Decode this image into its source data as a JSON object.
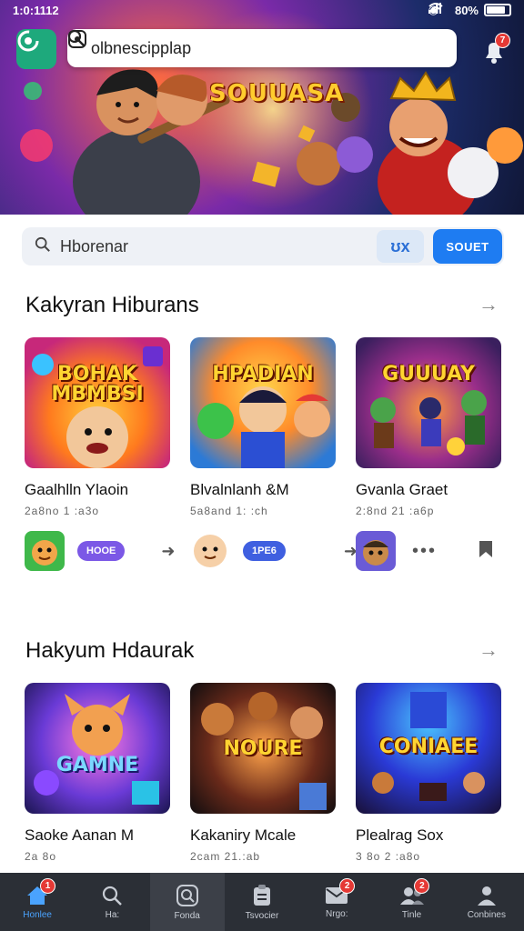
{
  "status_bar": {
    "time": "1:0:1112",
    "battery": "80%"
  },
  "top_search": {
    "value": "olbnescipplap"
  },
  "notifications": {
    "count": "7"
  },
  "hero": {
    "title": "SOUUASA"
  },
  "search2": {
    "value": "Hborenar",
    "clear_label": "ʊx",
    "button": "SOUET"
  },
  "sections": [
    {
      "title": "Kakyran Hiburans",
      "cards": [
        {
          "title": "Gaalhlln Ylaoin",
          "meta": "2a8no 1 :a3o",
          "art": "BOHAK MBMBSI"
        },
        {
          "title": "Blvalnlanh &M",
          "meta": "5a8and 1: :ch",
          "art": "HPADIAN"
        },
        {
          "title": "Gvanla Graet",
          "meta": "2:8nd 21 :a6p",
          "art": "GUUUAY"
        }
      ],
      "actions": [
        {
          "pill": "HOOE",
          "pill_color": "#7b58e6"
        },
        {
          "pill": "1PE6",
          "pill_color": "#3f5fe0"
        }
      ]
    },
    {
      "title": "Hakyum Hdaurak",
      "cards": [
        {
          "title": "Saoke Aanan M",
          "meta": "2a 8o",
          "art": "GAMNE"
        },
        {
          "title": "Kakaniry Mcale",
          "meta": "2cam 21.:ab",
          "art": "NOURE"
        },
        {
          "title": "Plealrag Sox",
          "meta": "3 8o 2 :a8o",
          "art": "CONIAEE"
        }
      ]
    }
  ],
  "bottom_nav": [
    {
      "label": "Honlee",
      "icon": "home-icon",
      "badge": "1"
    },
    {
      "label": "Ha:",
      "icon": "search-icon",
      "badge": ""
    },
    {
      "label": "Fonda",
      "icon": "lens-icon",
      "badge": ""
    },
    {
      "label": "Tsvocier",
      "icon": "clipboard-icon",
      "badge": ""
    },
    {
      "label": "Nrgo:",
      "icon": "mail-icon",
      "badge": "2"
    },
    {
      "label": "Tinle",
      "icon": "people-icon",
      "badge": "2"
    },
    {
      "label": "Conbines",
      "icon": "person-icon",
      "badge": ""
    }
  ],
  "colors": {
    "accent": "#1e7cf2",
    "nav_bg": "#2b2f36",
    "logo_green": "#1ea97c",
    "badge_red": "#e53935"
  }
}
